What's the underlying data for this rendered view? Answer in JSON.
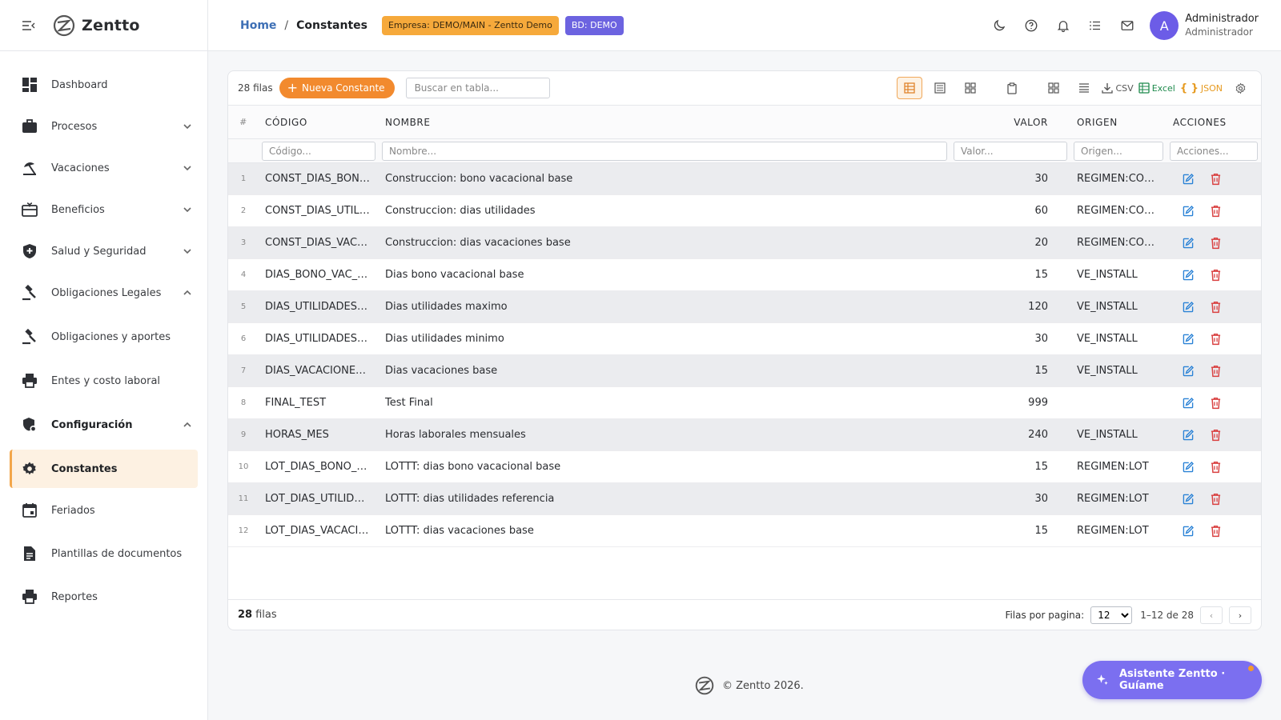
{
  "app": {
    "name": "Zentto"
  },
  "sidebar": {
    "items": [
      {
        "label": "Dashboard",
        "icon": "dashboard-icon",
        "chevron": ""
      },
      {
        "label": "Procesos",
        "icon": "briefcase-icon",
        "chevron": "down"
      },
      {
        "label": "Vacaciones",
        "icon": "beach-icon",
        "chevron": "down"
      },
      {
        "label": "Beneficios",
        "icon": "gift-card-icon",
        "chevron": "down"
      },
      {
        "label": "Salud y Seguridad",
        "icon": "shield-plus-icon",
        "chevron": "down"
      },
      {
        "label": "Obligaciones Legales",
        "icon": "gavel-icon",
        "chevron": "up"
      },
      {
        "label": "Obligaciones y aportes",
        "icon": "gavel-icon",
        "chevron": ""
      },
      {
        "label": "Entes y costo laboral",
        "icon": "printer-icon",
        "chevron": ""
      },
      {
        "label": "Configuración",
        "icon": "admin-settings-icon",
        "chevron": "up"
      },
      {
        "label": "Constantes",
        "icon": "gear-icon",
        "chevron": ""
      },
      {
        "label": "Feriados",
        "icon": "calendar-icon",
        "chevron": ""
      },
      {
        "label": "Plantillas de documentos",
        "icon": "document-icon",
        "chevron": ""
      },
      {
        "label": "Reportes",
        "icon": "printer-icon",
        "chevron": ""
      }
    ]
  },
  "header": {
    "breadcrumb_home": "Home",
    "breadcrumb_sep": "/",
    "breadcrumb_current": "Constantes",
    "chip_company": "Empresa: DEMO/MAIN - Zentto Demo",
    "chip_db": "BD: DEMO",
    "user_initial": "A",
    "user_name": "Administrador",
    "user_role": "Administrador"
  },
  "toolbar": {
    "rows_count": "28 filas",
    "new_button": "Nueva Constante",
    "search_placeholder": "Buscar en tabla...",
    "csv_label": "CSV",
    "excel_label": "Excel",
    "json_label": "JSON"
  },
  "table": {
    "headers": {
      "num": "#",
      "code": "CÓDIGO",
      "name": "NOMBRE",
      "value": "VALOR",
      "origin": "ORIGEN",
      "actions": "ACCIONES"
    },
    "filters": {
      "code": "Código...",
      "name": "Nombre...",
      "value": "Valor...",
      "origin": "Origen...",
      "actions": "Acciones..."
    },
    "rows": [
      {
        "n": "1",
        "code": "CONST_DIAS_BON…",
        "name": "Construccion: bono vacacional base",
        "value": "30",
        "origin": "REGIMEN:CO…"
      },
      {
        "n": "2",
        "code": "CONST_DIAS_UTIL…",
        "name": "Construccion: dias utilidades",
        "value": "60",
        "origin": "REGIMEN:CO…"
      },
      {
        "n": "3",
        "code": "CONST_DIAS_VAC…",
        "name": "Construccion: dias vacaciones base",
        "value": "20",
        "origin": "REGIMEN:CO…"
      },
      {
        "n": "4",
        "code": "DIAS_BONO_VAC_…",
        "name": "Dias bono vacacional base",
        "value": "15",
        "origin": "VE_INSTALL"
      },
      {
        "n": "5",
        "code": "DIAS_UTILIDADES…",
        "name": "Dias utilidades maximo",
        "value": "120",
        "origin": "VE_INSTALL"
      },
      {
        "n": "6",
        "code": "DIAS_UTILIDADES…",
        "name": "Dias utilidades minimo",
        "value": "30",
        "origin": "VE_INSTALL"
      },
      {
        "n": "7",
        "code": "DIAS_VACACIONE…",
        "name": "Dias vacaciones base",
        "value": "15",
        "origin": "VE_INSTALL"
      },
      {
        "n": "8",
        "code": "FINAL_TEST",
        "name": "Test Final",
        "value": "999",
        "origin": ""
      },
      {
        "n": "9",
        "code": "HORAS_MES",
        "name": "Horas laborales mensuales",
        "value": "240",
        "origin": "VE_INSTALL"
      },
      {
        "n": "10",
        "code": "LOT_DIAS_BONO_…",
        "name": "LOTTT: dias bono vacacional base",
        "value": "15",
        "origin": "REGIMEN:LOT"
      },
      {
        "n": "11",
        "code": "LOT_DIAS_UTILID…",
        "name": "LOTTT: dias utilidades referencia",
        "value": "30",
        "origin": "REGIMEN:LOT"
      },
      {
        "n": "12",
        "code": "LOT_DIAS_VACACI…",
        "name": "LOTTT: dias vacaciones base",
        "value": "15",
        "origin": "REGIMEN:LOT"
      }
    ]
  },
  "footer_bar": {
    "total_bold": "28",
    "total_suffix": "filas",
    "rows_per_page_label": "Filas por pagina:",
    "rows_per_page_value": "12",
    "range": "1–12 de 28",
    "prev": "‹",
    "next": "›"
  },
  "page_footer": {
    "copyright": "© Zentto 2026."
  },
  "assistant": {
    "label": "Asistente Zentto · Guíame"
  },
  "colors": {
    "accent_orange": "#f28a2e",
    "db_chip": "#6c63e0",
    "edit_icon": "#2a82d6",
    "delete_icon": "#d94040",
    "assistant": "#7b6ff0"
  }
}
